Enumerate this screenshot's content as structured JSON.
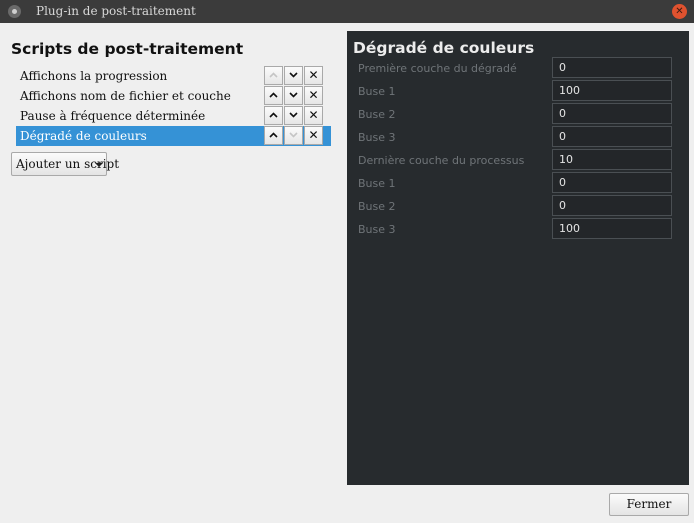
{
  "window": {
    "title": "Plug-in de post-traitement",
    "close_glyph": "✕"
  },
  "left": {
    "heading": "Scripts de post-traitement",
    "scripts": [
      {
        "name": "Affichons la progression",
        "up_enabled": false,
        "down_enabled": true,
        "selected": false
      },
      {
        "name": "Affichons nom de fichier et couche",
        "up_enabled": true,
        "down_enabled": true,
        "selected": false
      },
      {
        "name": "Pause à fréquence déterminée",
        "up_enabled": true,
        "down_enabled": true,
        "selected": false
      },
      {
        "name": "Dégradé de couleurs",
        "up_enabled": true,
        "down_enabled": false,
        "selected": true
      }
    ],
    "delete_glyph": "✕",
    "add_button": "Ajouter un script"
  },
  "right": {
    "title": "Dégradé de couleurs",
    "settings": [
      {
        "label": "Première couche du dégradé",
        "value": "0"
      },
      {
        "label": "Buse 1",
        "value": "100"
      },
      {
        "label": "Buse 2",
        "value": "0"
      },
      {
        "label": "Buse 3",
        "value": "0"
      },
      {
        "label": "Dernière couche du processus",
        "value": "10"
      },
      {
        "label": "Buse 1",
        "value": "0"
      },
      {
        "label": "Buse 2",
        "value": "0"
      },
      {
        "label": "Buse 3",
        "value": "100"
      }
    ]
  },
  "footer": {
    "close_button": "Fermer"
  },
  "colors": {
    "selection": "#3592d6",
    "panel_bg": "#272b2e",
    "titlebar_bg": "#3b3b3b",
    "close_circle": "#e0522f"
  },
  "icons": {
    "window_icon": "app-icon",
    "up": "chevron-up-icon",
    "down": "chevron-down-icon",
    "delete": "close-icon",
    "dropdown": "caret-down-icon"
  }
}
